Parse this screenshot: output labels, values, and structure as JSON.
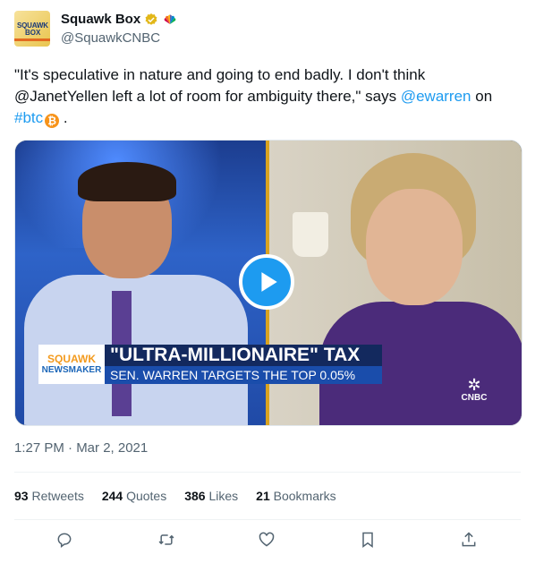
{
  "account": {
    "name": "Squawk Box",
    "handle": "@SquawkCNBC",
    "avatar_text_1": "SQUAWK",
    "avatar_text_2": "BOX"
  },
  "tweet": {
    "text_part1": "\"It's speculative in nature and going to end badly. I don't think @JanetYellen left a lot of room for ambiguity there,\" says ",
    "mention": "@ewarren",
    "text_part2": " on",
    "hashtag": "#btc",
    "btc_symbol": "₿",
    "text_end": " ."
  },
  "media": {
    "lower_third_logo_1": "SQUAWK",
    "lower_third_logo_2": "NEWSMAKER",
    "headline": "\"ULTRA-MILLIONAIRE\" TAX",
    "subheadline": "SEN. WARREN TARGETS THE TOP 0.05%",
    "network_bug": "CNBC"
  },
  "timestamp": "1:27 PM · Mar 2, 2021",
  "stats": {
    "retweets_count": "93",
    "retweets_label": "Retweets",
    "quotes_count": "244",
    "quotes_label": "Quotes",
    "likes_count": "386",
    "likes_label": "Likes",
    "bookmarks_count": "21",
    "bookmarks_label": "Bookmarks"
  },
  "icons": [
    "verified-badge-icon",
    "peacock-icon",
    "bitcoin-icon",
    "play-icon",
    "reply-icon",
    "retweet-icon",
    "like-icon",
    "bookmark-icon",
    "share-icon"
  ],
  "colors": {
    "accent": "#1d9bf0",
    "secondary_text": "#536471",
    "bitcoin": "#f7931a"
  }
}
